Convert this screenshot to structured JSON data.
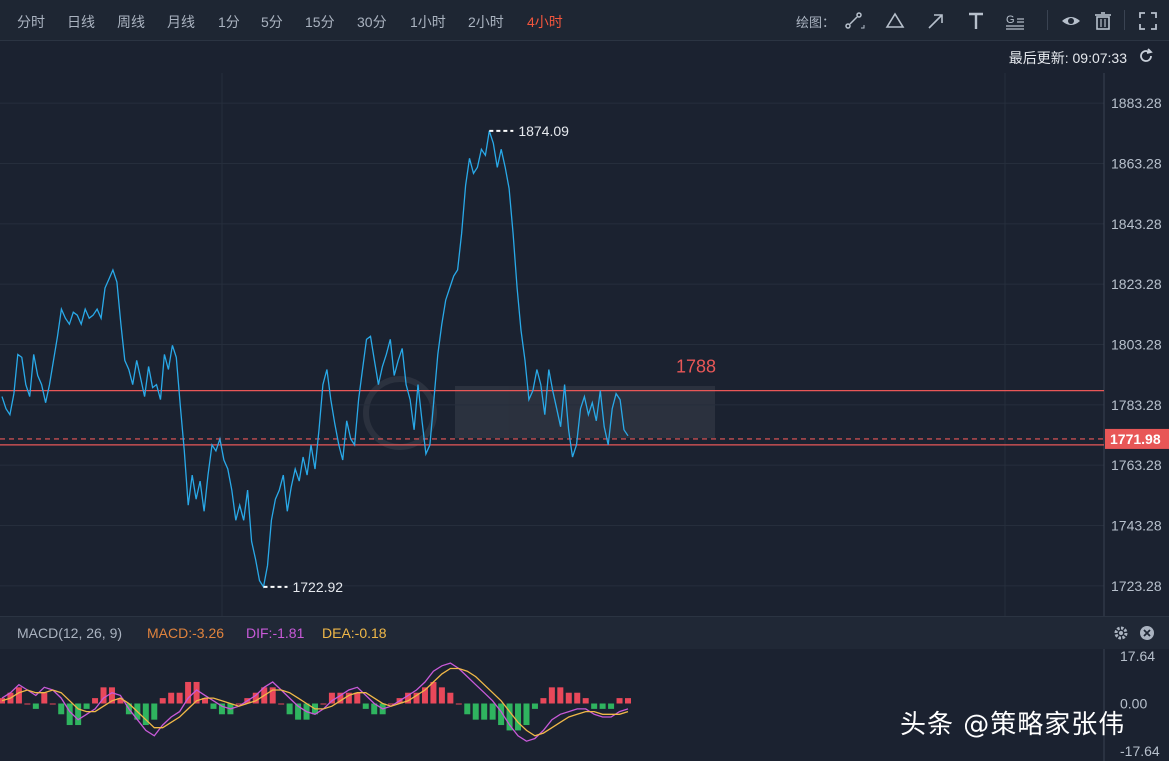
{
  "toolbar": {
    "timeframes": [
      "分时",
      "日线",
      "周线",
      "月线",
      "1分",
      "5分",
      "15分",
      "30分",
      "1小时",
      "2小时",
      "4小时"
    ],
    "active_timeframe": "4小时",
    "draw_label": "绘图：",
    "draw_tools": [
      "segment-icon",
      "triangle-icon",
      "arrow-icon",
      "text-icon",
      "fibonacci-icon"
    ],
    "view_tools": [
      "eye-icon",
      "trash-icon",
      "fullscreen-icon"
    ]
  },
  "update": {
    "label": "最后更新: 09:07:33"
  },
  "chart_data": [
    {
      "type": "line",
      "ylim": [
        1713.28,
        1893.28
      ],
      "yticks": [
        "1883.28",
        "1863.28",
        "1843.28",
        "1823.28",
        "1803.28",
        "1783.28",
        "1763.28",
        "1743.28",
        "1723.28"
      ],
      "series": [
        {
          "values": [
            1786,
            1782,
            1780,
            1787,
            1800,
            1799,
            1790,
            1786,
            1800,
            1793,
            1790,
            1784,
            1790,
            1798,
            1806,
            1815,
            1812,
            1810,
            1814,
            1813,
            1810,
            1815,
            1812,
            1813,
            1815,
            1812,
            1822,
            1825,
            1828,
            1824,
            1810,
            1798,
            1795,
            1790,
            1798,
            1792,
            1786,
            1796,
            1789,
            1790,
            1785,
            1800,
            1795,
            1803,
            1799,
            1783,
            1768,
            1750,
            1760,
            1752,
            1758,
            1748,
            1760,
            1770,
            1768,
            1772,
            1765,
            1762,
            1755,
            1745,
            1750,
            1745,
            1755,
            1738,
            1732,
            1725,
            1722.92,
            1730,
            1745,
            1752,
            1755,
            1760,
            1748,
            1756,
            1762,
            1758,
            1766,
            1760,
            1770,
            1762,
            1775,
            1790,
            1795,
            1785,
            1777,
            1770,
            1765,
            1778,
            1772,
            1770,
            1785,
            1795,
            1805,
            1806,
            1798,
            1790,
            1796,
            1800,
            1805,
            1793,
            1798,
            1802,
            1790,
            1785,
            1775,
            1790,
            1778,
            1767,
            1770,
            1785,
            1800,
            1810,
            1818,
            1822,
            1826,
            1828,
            1840,
            1856,
            1865,
            1860,
            1862,
            1868,
            1866,
            1874.09,
            1870,
            1862,
            1868,
            1862,
            1855,
            1840,
            1822,
            1808,
            1798,
            1785,
            1788,
            1795,
            1790,
            1780,
            1795,
            1788,
            1782,
            1776,
            1790,
            1775,
            1766,
            1770,
            1782,
            1786,
            1780,
            1784,
            1778,
            1788,
            1776,
            1770,
            1782,
            1787,
            1785,
            1775,
            1773
          ]
        }
      ],
      "high_label": "1874.09",
      "low_label": "1722.92",
      "levels": [
        {
          "value": 1788,
          "label": "1788",
          "color": "#e85757",
          "style": "solid"
        },
        {
          "value": 1770,
          "color": "#e85757",
          "style": "solid"
        },
        {
          "value": 1771.98,
          "label": "1771.98",
          "color": "#e85757",
          "style": "dashed"
        }
      ],
      "line_color": "#29a9e8"
    },
    {
      "type": "bar",
      "title": "MACD(12, 26, 9)",
      "macd_label": "MACD:-3.26",
      "dif_label": "DIF:-1.81",
      "dea_label": "DEA:-0.18",
      "ylim": [
        -17.64,
        17.64
      ],
      "yticks": [
        "17.64",
        "0.00",
        "-17.64"
      ],
      "series": [
        {
          "name": "DIF",
          "color": "#c85ad8",
          "values": [
            2,
            4,
            7,
            5,
            3,
            6,
            5,
            2,
            -3,
            -6,
            -4,
            -2,
            2,
            4,
            3,
            -2,
            -6,
            -10,
            -12,
            -8,
            -5,
            -3,
            2,
            5,
            3,
            1,
            -1,
            -2,
            -1,
            1,
            3,
            6,
            8,
            5,
            2,
            -1,
            -3,
            -4,
            -2,
            1,
            3,
            5,
            6,
            3,
            0,
            -2,
            -1,
            1,
            3,
            5,
            8,
            12,
            14,
            15,
            13,
            10,
            7,
            4,
            1,
            -3,
            -8,
            -12,
            -14,
            -13,
            -10,
            -6,
            -4,
            -3,
            -2,
            -2,
            -4,
            -5,
            -5,
            -3,
            -2
          ]
        },
        {
          "name": "DEA",
          "color": "#f0b848",
          "values": [
            1,
            2,
            4,
            5,
            4,
            4,
            5,
            4,
            1,
            -2,
            -3,
            -3,
            -1,
            1,
            2,
            0,
            -3,
            -6,
            -9,
            -9,
            -7,
            -5,
            -2,
            1,
            2,
            2,
            1,
            0,
            -1,
            0,
            1,
            3,
            5,
            5,
            4,
            2,
            0,
            -2,
            -2,
            -1,
            1,
            3,
            4,
            4,
            2,
            0,
            -1,
            0,
            1,
            3,
            5,
            8,
            11,
            13,
            13,
            12,
            10,
            7,
            4,
            1,
            -3,
            -7,
            -10,
            -12,
            -11,
            -9,
            -7,
            -5,
            -4,
            -3,
            -3,
            -4,
            -4,
            -4,
            -3
          ]
        },
        {
          "name": "MACD",
          "values": [
            2,
            4,
            6,
            0,
            -2,
            4,
            0,
            -4,
            -8,
            -8,
            -2,
            2,
            6,
            6,
            2,
            -4,
            -6,
            -8,
            -6,
            2,
            4,
            4,
            8,
            8,
            2,
            -2,
            -4,
            -4,
            0,
            2,
            4,
            6,
            6,
            0,
            -4,
            -6,
            -6,
            -4,
            0,
            4,
            4,
            4,
            4,
            -2,
            -4,
            -4,
            0,
            2,
            4,
            4,
            6,
            8,
            6,
            4,
            0,
            -4,
            -6,
            -6,
            -6,
            -8,
            -10,
            -10,
            -8,
            -2,
            2,
            6,
            6,
            4,
            4,
            2,
            -2,
            -2,
            -2,
            2,
            2
          ]
        }
      ]
    }
  ],
  "watermark": "头条 @策略家张伟"
}
